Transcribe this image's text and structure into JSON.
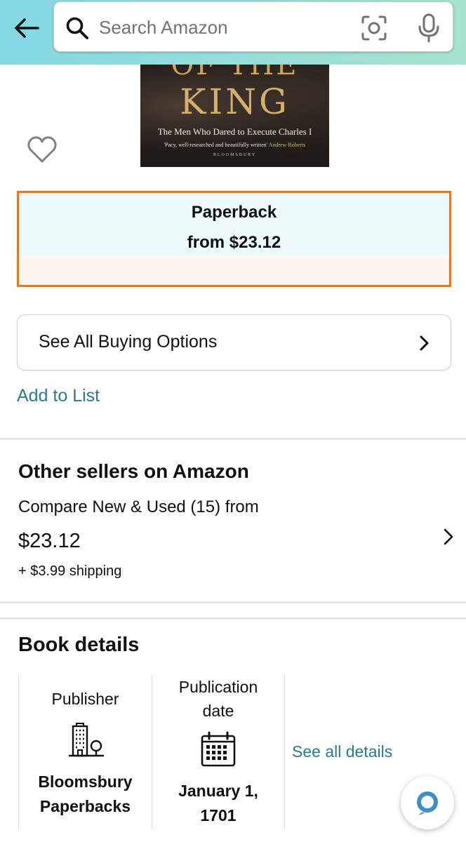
{
  "header": {
    "search_placeholder": "Search Amazon"
  },
  "cover": {
    "title_top": "OF THE",
    "title": "KING",
    "subtitle": "The Men Who Dared to Execute Charles I",
    "quote": "'Pacy, well-researched and beautifully written'",
    "quote_author": "Andrew Roberts",
    "publisher_mark": "BLOOMSBURY"
  },
  "format": {
    "name": "Paperback",
    "price": "from $23.12"
  },
  "buying_options": {
    "label": "See All Buying Options"
  },
  "add_to_list": "Add to List",
  "other_sellers": {
    "title": "Other sellers on Amazon",
    "compare": "Compare New & Used (15) from",
    "price": "$23.12",
    "shipping": "+ $3.99 shipping"
  },
  "book_details": {
    "title": "Book details",
    "publisher_label": "Publisher",
    "publisher_value_line1": "Bloomsbury",
    "publisher_value_line2": "Paperbacks",
    "pubdate_label_line1": "Publication",
    "pubdate_label_line2": "date",
    "pubdate_value_line1": "January 1,",
    "pubdate_value_line2": "1701",
    "see_all": "See all details"
  },
  "colors": {
    "header_gradient_start": "#84d8e3",
    "header_gradient_end": "#a6e3cf",
    "selected_border": "#d47c2f",
    "link": "#2b7a8f",
    "alexa": "#3d8fc6"
  },
  "icons": [
    "back-arrow-icon",
    "search-icon",
    "camera-icon",
    "microphone-icon",
    "heart-icon",
    "chevron-right-icon",
    "building-icon",
    "calendar-icon",
    "alexa-icon"
  ]
}
